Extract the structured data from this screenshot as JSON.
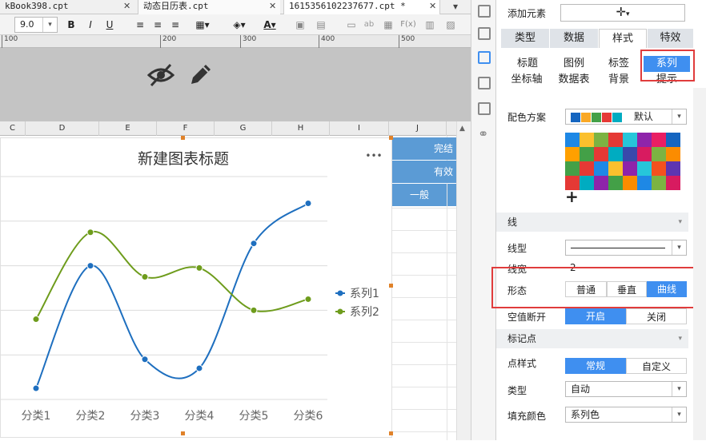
{
  "tabs": [
    {
      "label": "kBook398.cpt",
      "close": "✕"
    },
    {
      "label": "动态日历表.cpt",
      "close": "✕"
    },
    {
      "label": "1615356102237677.cpt *",
      "close": "✕"
    }
  ],
  "toolbar": {
    "font_size": "9.0",
    "bold": "B",
    "italic": "I",
    "underline": "U",
    "text_color": "A",
    "fx": "F(x)",
    "ab": "ab"
  },
  "ruler": {
    "ticks": [
      "100",
      "200",
      "300",
      "400",
      "500"
    ]
  },
  "columns": [
    "C",
    "D",
    "E",
    "F",
    "G",
    "H",
    "I",
    "J"
  ],
  "cells": {
    "c1": "完结",
    "c2": "有效",
    "c3": "一般"
  },
  "chart_data": {
    "type": "line",
    "title": "新建图表标题",
    "menu": "•••",
    "categories": [
      "分类1",
      "分类2",
      "分类3",
      "分类4",
      "分类5",
      "分类6"
    ],
    "series": [
      {
        "name": "系列1",
        "color": "#1e6fbf",
        "values": [
          0.25,
          3,
          0.9,
          0.7,
          3.5,
          4.4
        ]
      },
      {
        "name": "系列2",
        "color": "#6e9c1c",
        "values": [
          1.8,
          3.75,
          2.75,
          2.95,
          2,
          2.25
        ]
      }
    ],
    "ylim": [
      0,
      5
    ],
    "smooth": true,
    "legend": "right",
    "grid": true
  },
  "panel": {
    "add_element": "添加元素",
    "add_icon": "✛",
    "main_tabs": [
      "类型",
      "数据",
      "样式",
      "特效"
    ],
    "sub_tabs_row1": [
      "标题",
      "图例",
      "标签",
      "系列"
    ],
    "sub_tabs_row2": [
      "坐标轴",
      "数据表",
      "背景",
      "提示"
    ],
    "color_scheme_label": "配色方案",
    "color_scheme_value": "默认",
    "palette_add": "+",
    "section_line": "线",
    "line_type_label": "线型",
    "line_width_label": "线宽",
    "line_width_value": "2",
    "shape_label": "形态",
    "shape_options": [
      "普通",
      "垂直",
      "曲线"
    ],
    "null_break_label": "空值断开",
    "null_break_options": [
      "开启",
      "关闭"
    ],
    "section_marker": "标记点",
    "marker_style_label": "点样式",
    "marker_style_options": [
      "常规",
      "自定义"
    ],
    "type_label": "类型",
    "type_value": "自动",
    "fill_label": "填充颜色",
    "fill_value": "系列色",
    "palette_top": [
      "#1565c0",
      "#f9a825",
      "#43a047",
      "#e53935",
      "#00acc1"
    ],
    "palette_grid": [
      [
        "#1e88e5",
        "#fbc02d",
        "#7cb342",
        "#e53935",
        "#26c6da",
        "#8e24aa",
        "#e91e63",
        "#1565c0"
      ],
      [
        "#ffa000",
        "#43a047",
        "#e53935",
        "#00acc1",
        "#3949ab",
        "#d81b60",
        "#7cb342",
        "#fb8c00"
      ],
      [
        "#43a047",
        "#e53935",
        "#1e88e5",
        "#fbc02d",
        "#8e24aa",
        "#26c6da",
        "#f4511e",
        "#5e35b1"
      ],
      [
        "#e53935",
        "#00acc1",
        "#8e24aa",
        "#43a047",
        "#fb8c00",
        "#1e88e5",
        "#7cb342",
        "#d81b60"
      ]
    ]
  },
  "accent": "#3f8ff0"
}
